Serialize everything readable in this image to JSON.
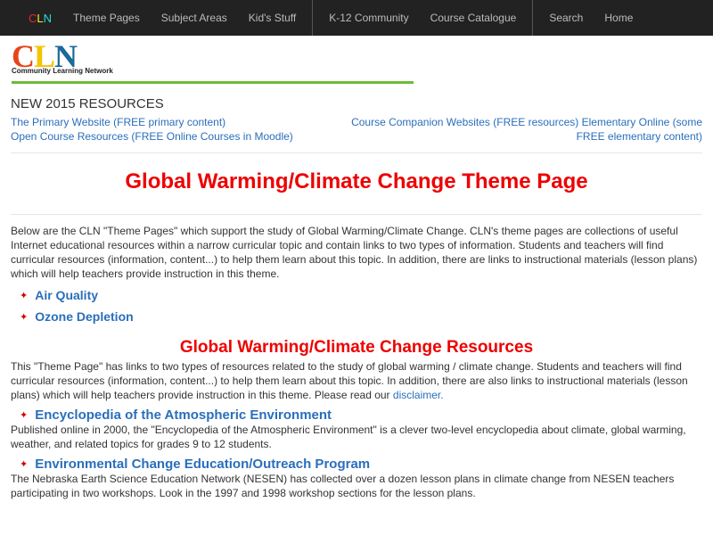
{
  "nav": {
    "brand": "CLN",
    "items": [
      "Theme Pages",
      "Subject Areas",
      "Kid's Stuff",
      "K-12 Community",
      "Course Catalogue",
      "Search",
      "Home"
    ]
  },
  "logo": {
    "c": "C",
    "l": "L",
    "n": "N",
    "subtitle": "Community Learning Network"
  },
  "new_resources": {
    "heading": "NEW 2015 RESOURCES",
    "left": [
      "The Primary Website (FREE primary content)",
      "Open Course Resources (FREE Online Courses in Moodle)"
    ],
    "right": [
      "Course Companion Websites (FREE resources) Elementary Online (some",
      "FREE elementary content)"
    ]
  },
  "title": "Global Warming/Climate Change Theme Page",
  "intro": "Below are the CLN \"Theme Pages\" which support the study of Global Warming/Climate Change. CLN's theme pages are collections of useful Internet educational resources within a narrow curricular topic and contain links to two types of information. Students and teachers will find curricular resources (information, content...) to help them learn about this topic. In addition, there are links to instructional materials (lesson plans) which will help teachers provide instruction in this theme.",
  "topics": [
    "Air Quality",
    "Ozone Depletion"
  ],
  "resources": {
    "heading": "Global Warming/Climate Change Resources",
    "intro": "This \"Theme Page\" has links to two types of resources related to the study of global warming / climate change. Students and teachers will find curricular resources (information, content...) to help them learn about this topic. In addition, there are also links to instructional materials (lesson plans) which will help teachers provide instruction in this theme. Please read our ",
    "disclaimer": "disclaimer.",
    "entries": [
      {
        "title": "Encyclopedia of the Atmospheric Environment",
        "desc": "Published online in 2000, the \"Encyclopedia of the Atmospheric Environment\" is a clever two-level encyclopedia about climate, global warming, weather, and related topics for grades 9 to 12 students."
      },
      {
        "title": "Environmental Change Education/Outreach Program",
        "desc": "The Nebraska Earth Science Education Network (NESEN) has collected over a dozen lesson plans in climate change from NESEN teachers participating in two workshops. Look in the 1997 and 1998 workshop sections for the lesson plans."
      }
    ]
  }
}
